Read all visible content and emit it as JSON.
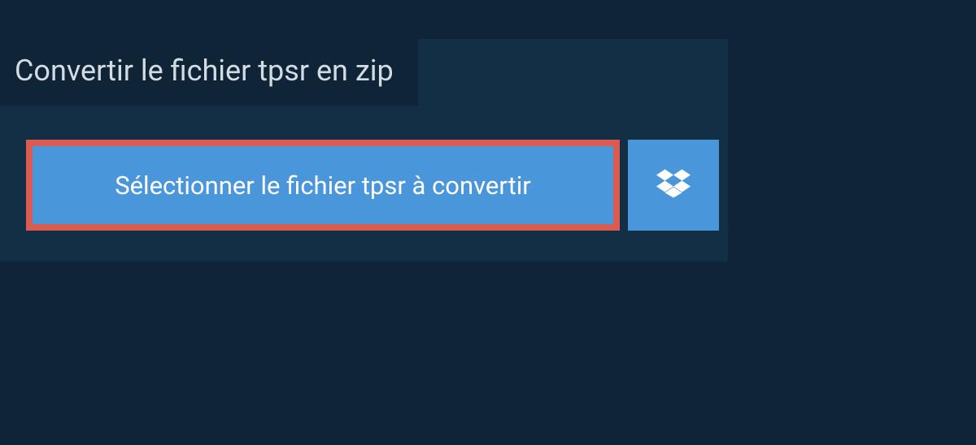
{
  "title": "Convertir le fichier tpsr en zip",
  "select_button_label": "Sélectionner le fichier tpsr à convertir",
  "dropbox_icon_name": "dropbox-icon"
}
